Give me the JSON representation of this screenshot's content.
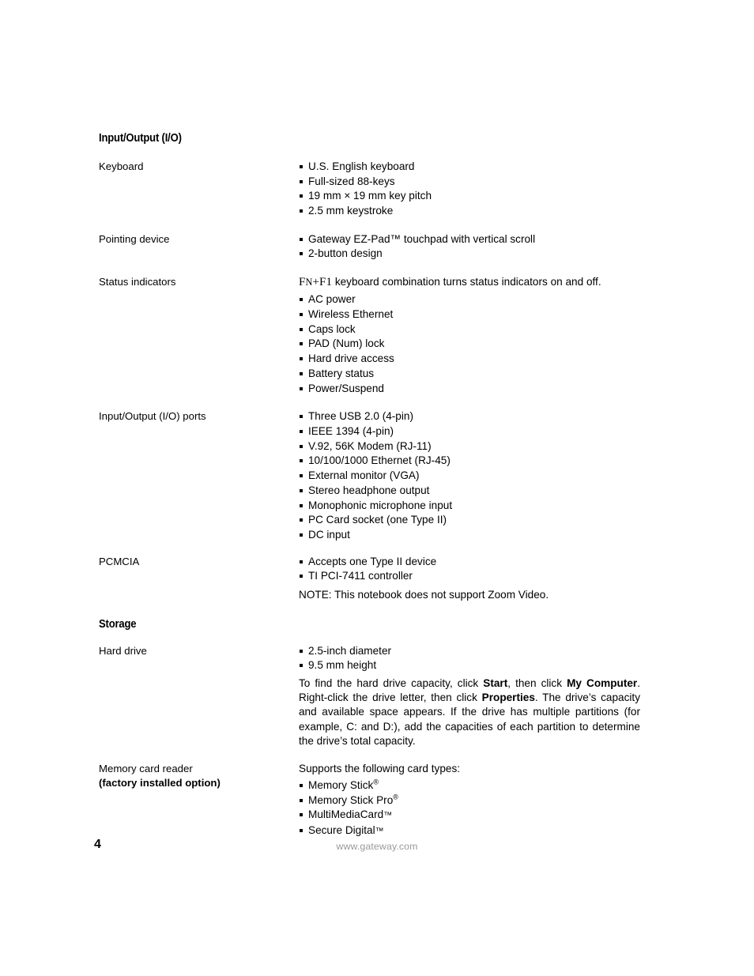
{
  "document": {
    "sections": [
      {
        "heading": "Input/Output (I/O)",
        "rows": [
          {
            "label": "Keyboard",
            "bullets": [
              "U.S. English keyboard",
              "Full-sized 88-keys",
              "19 mm × 19 mm key pitch",
              "2.5 mm keystroke"
            ]
          },
          {
            "label": "Pointing device",
            "bullets": [
              "Gateway EZ-Pad™ touchpad with vertical scroll",
              "2-button design"
            ]
          },
          {
            "label": "Status indicators",
            "intro_prefix": "F",
            "intro_smallcap": "N",
            "intro_suffix": "+F1",
            "intro_text": " keyboard combination turns status indicators on and off.",
            "bullets": [
              "AC power",
              "Wireless Ethernet",
              "Caps lock",
              "PAD (Num) lock",
              "Hard drive access",
              "Battery status",
              "Power/Suspend"
            ]
          },
          {
            "label": "Input/Output (I/O) ports",
            "bullets": [
              "Three USB 2.0 (4-pin)",
              "IEEE 1394 (4-pin)",
              "V.92, 56K Modem (RJ-11)",
              "10/100/1000 Ethernet (RJ-45)",
              "External monitor (VGA)",
              "Stereo headphone output",
              "Monophonic microphone input",
              "PC Card socket (one Type II)",
              "DC input"
            ]
          },
          {
            "label": "PCMCIA",
            "bullets": [
              "Accepts one Type II device",
              "TI PCI-7411 controller"
            ],
            "note": "NOTE: This notebook does not support Zoom Video."
          }
        ]
      },
      {
        "heading": "Storage",
        "rows": [
          {
            "label": "Hard drive",
            "bullets": [
              "2.5-inch diameter",
              "9.5 mm height"
            ],
            "paragraph": {
              "part1": "To find the hard drive capacity, click ",
              "bold1": "Start",
              "part2": ", then click ",
              "bold2": "My Computer",
              "part3": ". Right-click the drive letter, then click ",
              "bold3": "Properties",
              "part4": ". The drive’s capacity and available space appears. If the drive has multiple partitions (for example, C: and D:), add the capacities of each partition to determine the drive’s total capacity."
            }
          },
          {
            "label_line1": "Memory card reader",
            "label_line2": "(factory installed option)",
            "intro": "Supports the following card types:",
            "cards": [
              {
                "name": "Memory Stick",
                "mark": "reg"
              },
              {
                "name": "Memory Stick Pro",
                "mark": "reg"
              },
              {
                "name": "MultiMediaCard",
                "mark": "tm"
              },
              {
                "name": "Secure Digital",
                "mark": "tm"
              }
            ]
          }
        ]
      }
    ]
  },
  "footer": {
    "page_number": "4",
    "url": "www.gateway.com"
  }
}
